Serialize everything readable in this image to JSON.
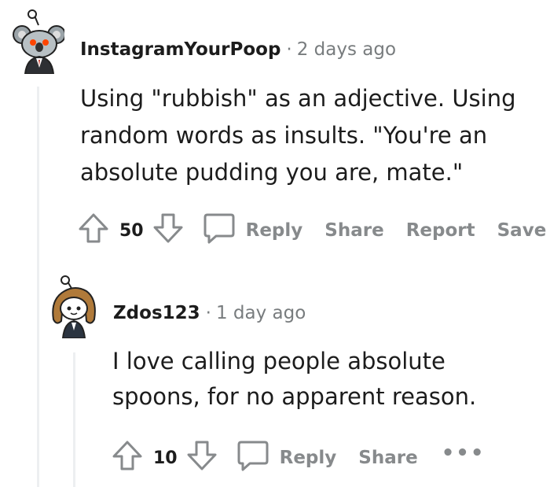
{
  "comments": [
    {
      "author": "InstagramYourPoop",
      "separator": "·",
      "time": "2 days ago",
      "body_lines": [
        "Using \"rubbish\" as an adjective. Using",
        "random words as insults. \"You're an",
        "absolute pudding you are, mate.\""
      ],
      "score": "50",
      "actions": {
        "reply": "Reply",
        "share": "Share",
        "report": "Report",
        "save": "Save"
      },
      "avatar_icon": "koala-snoo-avatar"
    },
    {
      "author": "Zdos123",
      "separator": "·",
      "time": "1 day ago",
      "body_lines": [
        "I love calling people absolute",
        "spoons, for no apparent reason."
      ],
      "score": "10",
      "actions": {
        "reply": "Reply",
        "share": "Share",
        "more": "•••"
      },
      "avatar_icon": "curly-hair-snoo-avatar"
    }
  ],
  "colors": {
    "text": "#1c1c1c",
    "muted": "#878a8c",
    "meta": "#787c7e",
    "threadline": "#edeff1"
  }
}
